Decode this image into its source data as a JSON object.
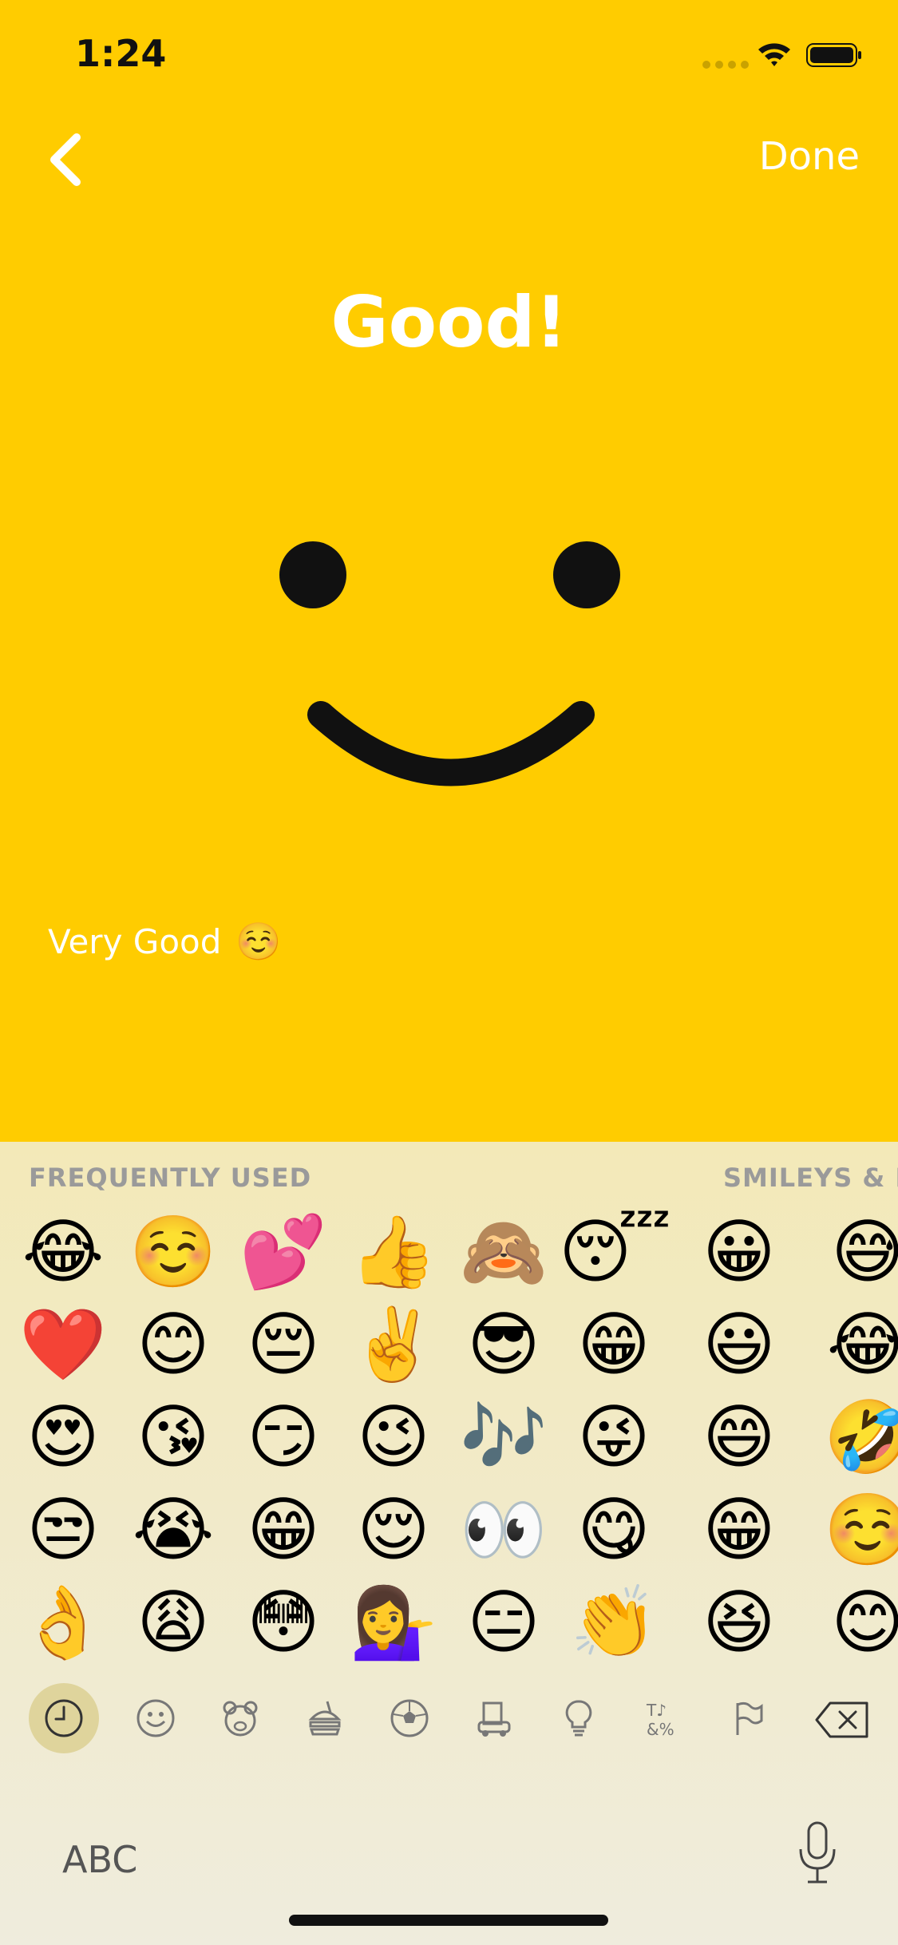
{
  "status_bar": {
    "time": "1:24"
  },
  "nav": {
    "done_label": "Done"
  },
  "mood": {
    "title": "Good!"
  },
  "note": {
    "text": "Very Good",
    "emoji": "☺️"
  },
  "keyboard": {
    "section_frequent": "FREQUENTLY USED",
    "section_smileys": "SMILEYS & P",
    "rows": [
      [
        "😂",
        "☺️",
        "💕",
        "👍",
        "🙈",
        "😴",
        "😀",
        "😅"
      ],
      [
        "❤️",
        "😊",
        "😔",
        "✌️",
        "😎",
        "😁",
        "😃",
        "😂"
      ],
      [
        "😍",
        "😘",
        "😏",
        "😉",
        "🎶",
        "😜",
        "😄",
        "🤣"
      ],
      [
        "😒",
        "😭",
        "😁",
        "😌",
        "👀",
        "😋",
        "😁",
        "☺️"
      ],
      [
        "👌",
        "😩",
        "😳",
        "💁‍♀️",
        "😑",
        "👏",
        "😆",
        "😊"
      ]
    ],
    "abc_label": "ABC"
  }
}
